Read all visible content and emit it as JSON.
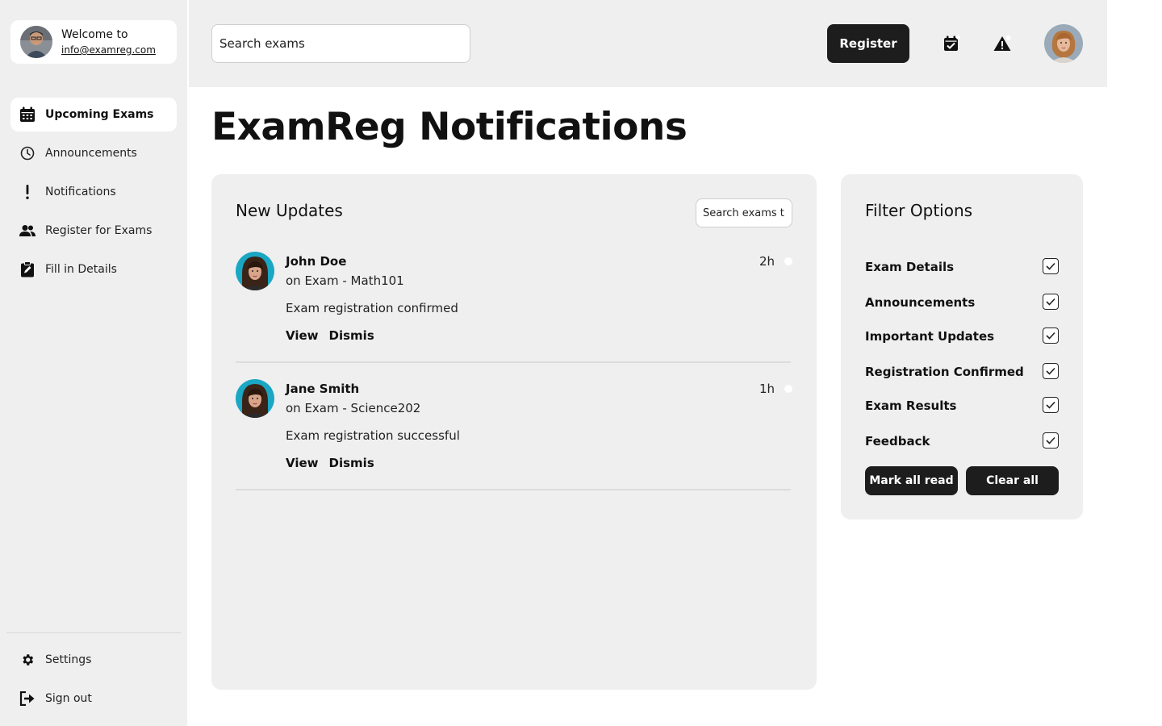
{
  "sidebar": {
    "welcome": "Welcome to",
    "email": "info@examreg.com",
    "items": [
      {
        "label": "Upcoming Exams",
        "icon": "calendar-icon"
      },
      {
        "label": "Announcements",
        "icon": "clock-icon"
      },
      {
        "label": "Notifications",
        "icon": "exclamation-icon"
      },
      {
        "label": "Register for Exams",
        "icon": "people-icon"
      },
      {
        "label": "Fill in Details",
        "icon": "clipboard-edit-icon"
      }
    ],
    "bottom": [
      {
        "label": "Settings",
        "icon": "gear-icon"
      },
      {
        "label": "Sign out",
        "icon": "sign-out-icon"
      }
    ]
  },
  "header": {
    "search_placeholder": "Search exams",
    "register_label": "Register",
    "icons": [
      "calendar-check-icon",
      "warning-icon"
    ]
  },
  "page": {
    "title": "ExamReg Notifications"
  },
  "updates": {
    "title": "New Updates",
    "search_placeholder": "Search exams th",
    "items": [
      {
        "name": "John Doe",
        "exam": "on Exam - Math101",
        "message": "Exam registration confirmed",
        "time": "2h",
        "view": "View",
        "dismiss": "Dismis"
      },
      {
        "name": "Jane Smith",
        "exam": "on Exam - Science202",
        "message": "Exam registration successful",
        "time": "1h",
        "view": "View",
        "dismiss": "Dismis"
      }
    ]
  },
  "filters": {
    "title": "Filter Options",
    "options": [
      {
        "label": "Exam Details",
        "checked": true
      },
      {
        "label": "Announcements",
        "checked": true
      },
      {
        "label": "Important Updates",
        "checked": true
      },
      {
        "label": "Registration Confirmed",
        "checked": true
      },
      {
        "label": "Exam Results",
        "checked": true
      },
      {
        "label": "Feedback",
        "checked": true
      }
    ],
    "mark_all_read": "Mark all read",
    "clear_all": "Clear all"
  },
  "colors": {
    "panel_bg": "#efefef",
    "button_dark": "#1d1d1d",
    "accent_teal": "#1aa7c4"
  }
}
